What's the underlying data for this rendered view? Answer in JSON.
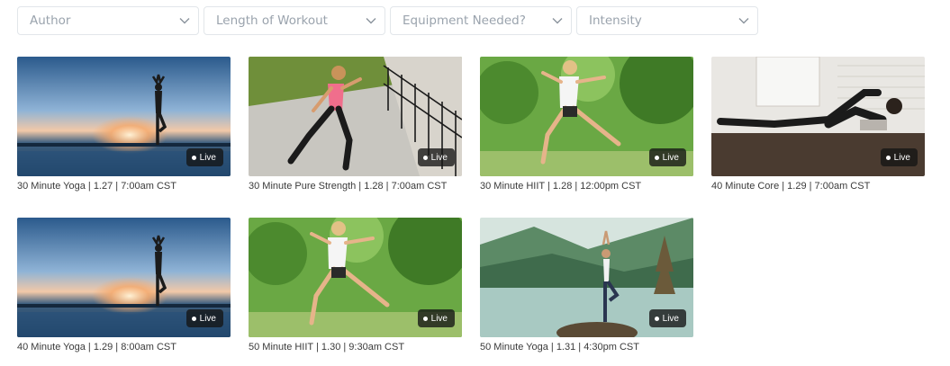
{
  "filters": [
    {
      "label": "Author",
      "icon": "chevron-down-icon"
    },
    {
      "label": "Length of Workout",
      "icon": "chevron-down-icon"
    },
    {
      "label": "Equipment Needed?",
      "icon": "chevron-down-icon"
    },
    {
      "label": "Intensity",
      "icon": "chevron-down-icon"
    }
  ],
  "live_label": "Live",
  "workouts": [
    {
      "caption": "30 Minute Yoga | 1.27 | 7:00am CST",
      "scene": "yoga-sunset"
    },
    {
      "caption": "30 Minute Pure Strength | 1.28 | 7:00am CST",
      "scene": "strength-lunge"
    },
    {
      "caption": "30 Minute HIIT | 1.28 | 12:00pm CST",
      "scene": "hiit-jump"
    },
    {
      "caption": "40 Minute Core | 1.29 | 7:00am CST",
      "scene": "core-floor"
    },
    {
      "caption": "40 Minute Yoga | 1.29 | 8:00am CST",
      "scene": "yoga-sunset"
    },
    {
      "caption": "50 Minute HIIT | 1.30 | 9:30am CST",
      "scene": "hiit-jump"
    },
    {
      "caption": "50 Minute Yoga | 1.31 | 4:30pm CST",
      "scene": "yoga-lake"
    }
  ],
  "colors": {
    "filter_border": "#e2e6ea",
    "filter_text": "#9aa3ad",
    "live_badge_bg": "#141414"
  }
}
